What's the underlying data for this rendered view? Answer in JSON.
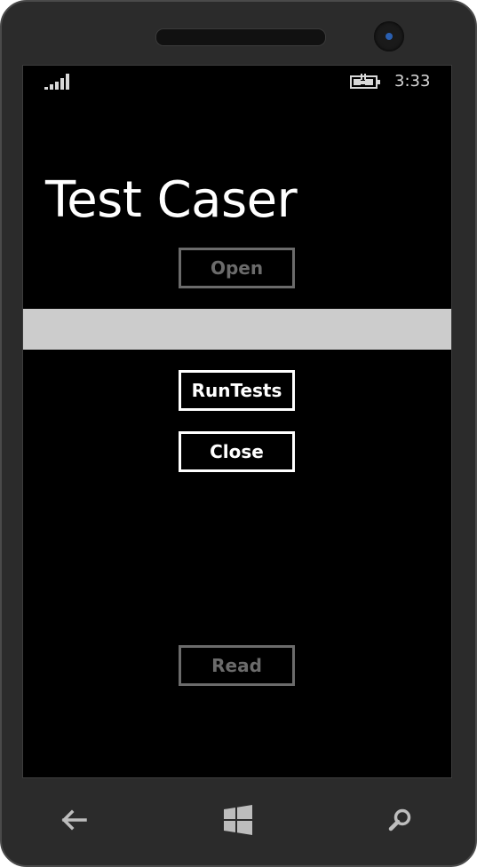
{
  "status_bar": {
    "signal_icon": "signal-strength-icon",
    "battery_icon": "battery-charging-icon",
    "time": "3:33"
  },
  "app": {
    "title": "Test Caser",
    "buttons": {
      "open": "Open",
      "run_tests": "RunTests",
      "close": "Close",
      "read": "Read"
    },
    "text_box": {
      "value": ""
    }
  },
  "hardware_nav": {
    "back_icon": "back-arrow-icon",
    "start_icon": "windows-logo-icon",
    "search_icon": "search-icon"
  },
  "colors": {
    "screen_background": "#000000",
    "foreground": "#ffffff",
    "disabled": "#6b6b6b",
    "text_box_background": "#cccccc",
    "phone_body": "#2b2b2b"
  }
}
